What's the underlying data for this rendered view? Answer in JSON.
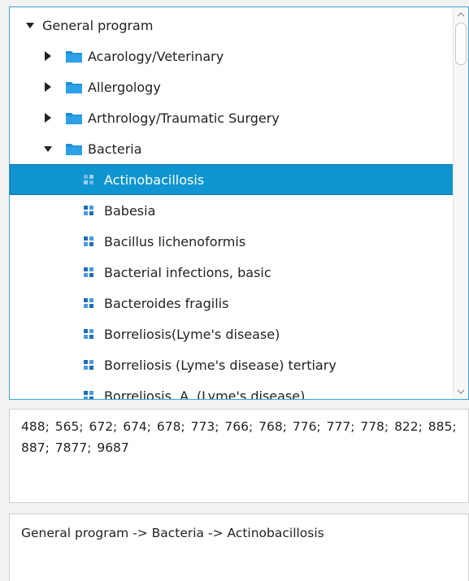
{
  "tree": {
    "items": [
      {
        "label": "General program",
        "expanded": true,
        "type": "root"
      },
      {
        "label": "Acarology/Veterinary",
        "expanded": false,
        "type": "folder"
      },
      {
        "label": "Allergology",
        "expanded": false,
        "type": "folder"
      },
      {
        "label": "Arthrology/Traumatic Surgery",
        "expanded": false,
        "type": "folder"
      },
      {
        "label": "Bacteria",
        "expanded": true,
        "type": "folder"
      },
      {
        "label": "Actinobacillosis",
        "type": "program",
        "selected": true
      },
      {
        "label": "Babesia",
        "type": "program"
      },
      {
        "label": "Bacillus lichenoformis",
        "type": "program"
      },
      {
        "label": "Bacterial infections, basic",
        "type": "program"
      },
      {
        "label": "Bacteroides fragilis",
        "type": "program"
      },
      {
        "label": "Borreliosis(Lyme's disease)",
        "type": "program"
      },
      {
        "label": "Borreliosis (Lyme's disease) tertiary",
        "type": "program"
      },
      {
        "label": "Borreliosis, A. (Lyme's disease)",
        "type": "program"
      }
    ]
  },
  "codes": {
    "text": "488; 565; 672; 674; 678; 773; 766; 768; 776; 777; 778; 822; 885; 887; 7877; 9687"
  },
  "path": {
    "text": "General program -> Bacteria -> Actinobacillosis"
  },
  "colors": {
    "selection": "#0f95d0",
    "panel_border": "#3ba6d8",
    "folder": "#1a8fd6",
    "program_icon": "#1e6eb8"
  }
}
